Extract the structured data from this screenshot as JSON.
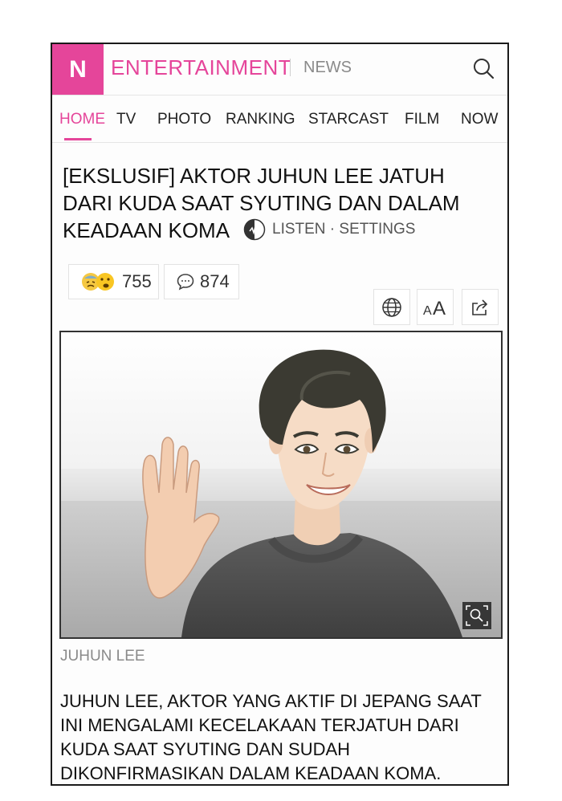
{
  "header": {
    "logo_letter": "N",
    "brand": "ENTERTAINMENT",
    "section": "NEWS"
  },
  "nav": {
    "items": [
      {
        "label": "HOME",
        "active": true
      },
      {
        "label": "TV"
      },
      {
        "label": "PHOTO"
      },
      {
        "label": "RANKING"
      },
      {
        "label": "STARCAST"
      },
      {
        "label": "FILM"
      },
      {
        "label": "NOW"
      }
    ]
  },
  "article": {
    "headline": "[EKSLUSIF] AKTOR JUHUN LEE JATUH DARI KUDA SAAT SYUTING DAN DALAM KEADAAN KOMA",
    "listen_label": "LISTEN · SETTINGS",
    "reactions_count": "755",
    "comments_count": "874",
    "photo_caption": "JUHUN LEE",
    "body": "JUHUN LEE, AKTOR YANG AKTIF DI JEPANG SAAT INI MENGALAMI KECELAKAAN TERJATUH DARI KUDA SAAT SYUTING DAN SUDAH DIKONFIRMASIKAN DALAM KEADAAN KOMA.",
    "font_size_label": "AA"
  },
  "colors": {
    "accent": "#e5459a"
  }
}
